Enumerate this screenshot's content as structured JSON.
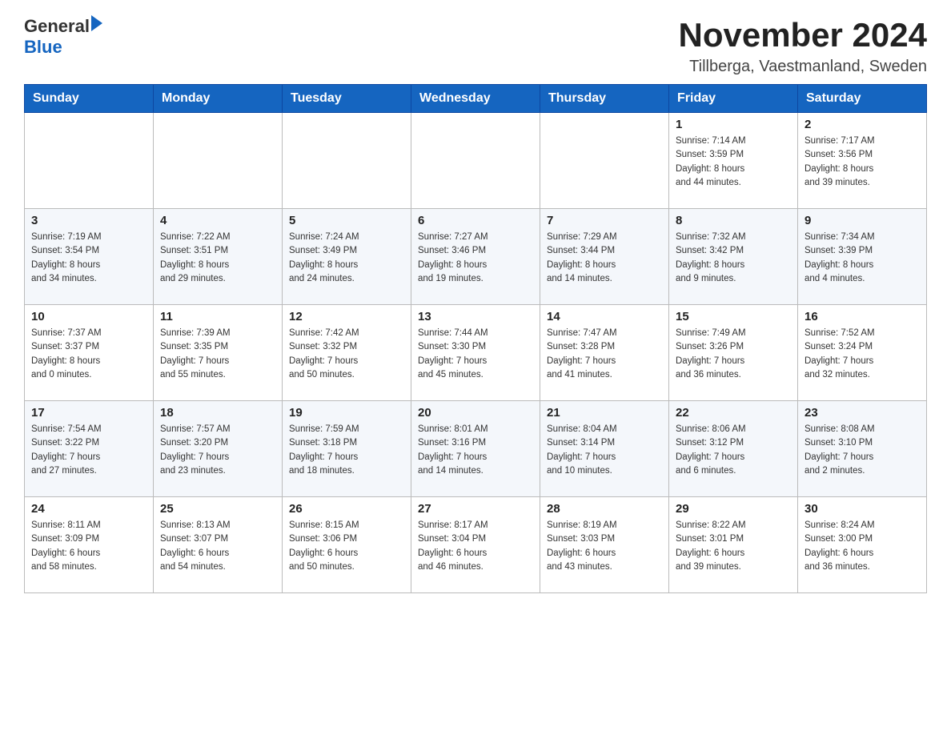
{
  "header": {
    "logo_general": "General",
    "logo_blue": "Blue",
    "month_title": "November 2024",
    "location": "Tillberga, Vaestmanland, Sweden"
  },
  "days_of_week": [
    "Sunday",
    "Monday",
    "Tuesday",
    "Wednesday",
    "Thursday",
    "Friday",
    "Saturday"
  ],
  "weeks": [
    {
      "days": [
        {
          "number": "",
          "info": ""
        },
        {
          "number": "",
          "info": ""
        },
        {
          "number": "",
          "info": ""
        },
        {
          "number": "",
          "info": ""
        },
        {
          "number": "",
          "info": ""
        },
        {
          "number": "1",
          "info": "Sunrise: 7:14 AM\nSunset: 3:59 PM\nDaylight: 8 hours\nand 44 minutes."
        },
        {
          "number": "2",
          "info": "Sunrise: 7:17 AM\nSunset: 3:56 PM\nDaylight: 8 hours\nand 39 minutes."
        }
      ]
    },
    {
      "days": [
        {
          "number": "3",
          "info": "Sunrise: 7:19 AM\nSunset: 3:54 PM\nDaylight: 8 hours\nand 34 minutes."
        },
        {
          "number": "4",
          "info": "Sunrise: 7:22 AM\nSunset: 3:51 PM\nDaylight: 8 hours\nand 29 minutes."
        },
        {
          "number": "5",
          "info": "Sunrise: 7:24 AM\nSunset: 3:49 PM\nDaylight: 8 hours\nand 24 minutes."
        },
        {
          "number": "6",
          "info": "Sunrise: 7:27 AM\nSunset: 3:46 PM\nDaylight: 8 hours\nand 19 minutes."
        },
        {
          "number": "7",
          "info": "Sunrise: 7:29 AM\nSunset: 3:44 PM\nDaylight: 8 hours\nand 14 minutes."
        },
        {
          "number": "8",
          "info": "Sunrise: 7:32 AM\nSunset: 3:42 PM\nDaylight: 8 hours\nand 9 minutes."
        },
        {
          "number": "9",
          "info": "Sunrise: 7:34 AM\nSunset: 3:39 PM\nDaylight: 8 hours\nand 4 minutes."
        }
      ]
    },
    {
      "days": [
        {
          "number": "10",
          "info": "Sunrise: 7:37 AM\nSunset: 3:37 PM\nDaylight: 8 hours\nand 0 minutes."
        },
        {
          "number": "11",
          "info": "Sunrise: 7:39 AM\nSunset: 3:35 PM\nDaylight: 7 hours\nand 55 minutes."
        },
        {
          "number": "12",
          "info": "Sunrise: 7:42 AM\nSunset: 3:32 PM\nDaylight: 7 hours\nand 50 minutes."
        },
        {
          "number": "13",
          "info": "Sunrise: 7:44 AM\nSunset: 3:30 PM\nDaylight: 7 hours\nand 45 minutes."
        },
        {
          "number": "14",
          "info": "Sunrise: 7:47 AM\nSunset: 3:28 PM\nDaylight: 7 hours\nand 41 minutes."
        },
        {
          "number": "15",
          "info": "Sunrise: 7:49 AM\nSunset: 3:26 PM\nDaylight: 7 hours\nand 36 minutes."
        },
        {
          "number": "16",
          "info": "Sunrise: 7:52 AM\nSunset: 3:24 PM\nDaylight: 7 hours\nand 32 minutes."
        }
      ]
    },
    {
      "days": [
        {
          "number": "17",
          "info": "Sunrise: 7:54 AM\nSunset: 3:22 PM\nDaylight: 7 hours\nand 27 minutes."
        },
        {
          "number": "18",
          "info": "Sunrise: 7:57 AM\nSunset: 3:20 PM\nDaylight: 7 hours\nand 23 minutes."
        },
        {
          "number": "19",
          "info": "Sunrise: 7:59 AM\nSunset: 3:18 PM\nDaylight: 7 hours\nand 18 minutes."
        },
        {
          "number": "20",
          "info": "Sunrise: 8:01 AM\nSunset: 3:16 PM\nDaylight: 7 hours\nand 14 minutes."
        },
        {
          "number": "21",
          "info": "Sunrise: 8:04 AM\nSunset: 3:14 PM\nDaylight: 7 hours\nand 10 minutes."
        },
        {
          "number": "22",
          "info": "Sunrise: 8:06 AM\nSunset: 3:12 PM\nDaylight: 7 hours\nand 6 minutes."
        },
        {
          "number": "23",
          "info": "Sunrise: 8:08 AM\nSunset: 3:10 PM\nDaylight: 7 hours\nand 2 minutes."
        }
      ]
    },
    {
      "days": [
        {
          "number": "24",
          "info": "Sunrise: 8:11 AM\nSunset: 3:09 PM\nDaylight: 6 hours\nand 58 minutes."
        },
        {
          "number": "25",
          "info": "Sunrise: 8:13 AM\nSunset: 3:07 PM\nDaylight: 6 hours\nand 54 minutes."
        },
        {
          "number": "26",
          "info": "Sunrise: 8:15 AM\nSunset: 3:06 PM\nDaylight: 6 hours\nand 50 minutes."
        },
        {
          "number": "27",
          "info": "Sunrise: 8:17 AM\nSunset: 3:04 PM\nDaylight: 6 hours\nand 46 minutes."
        },
        {
          "number": "28",
          "info": "Sunrise: 8:19 AM\nSunset: 3:03 PM\nDaylight: 6 hours\nand 43 minutes."
        },
        {
          "number": "29",
          "info": "Sunrise: 8:22 AM\nSunset: 3:01 PM\nDaylight: 6 hours\nand 39 minutes."
        },
        {
          "number": "30",
          "info": "Sunrise: 8:24 AM\nSunset: 3:00 PM\nDaylight: 6 hours\nand 36 minutes."
        }
      ]
    }
  ]
}
